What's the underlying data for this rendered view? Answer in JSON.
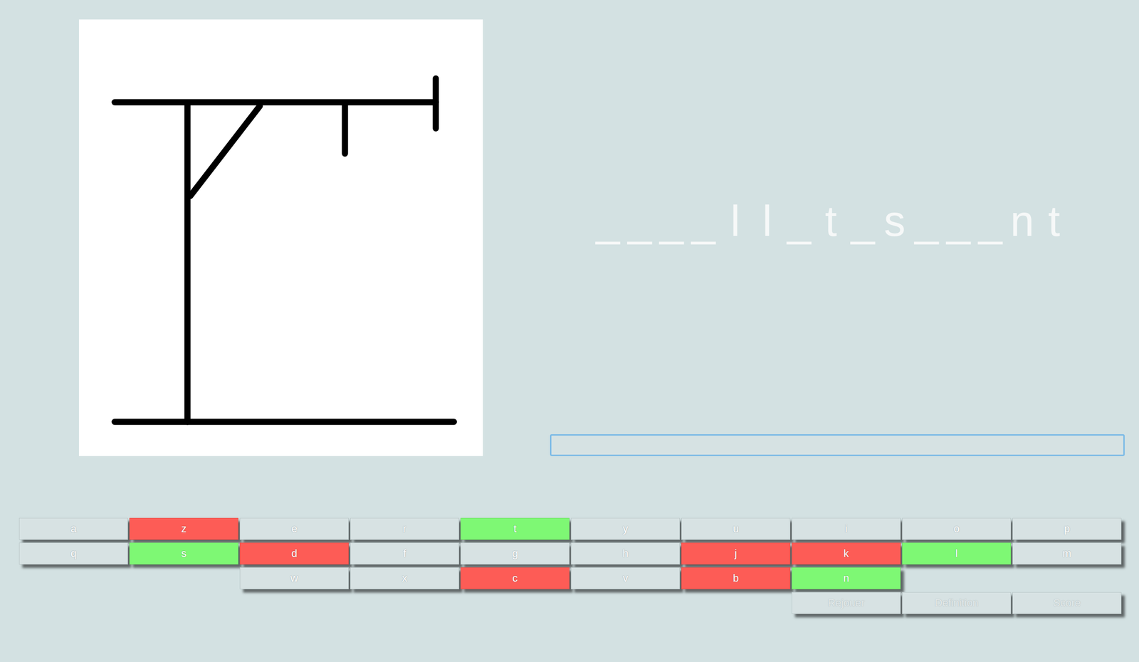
{
  "hangman": {
    "stage": 6
  },
  "word": {
    "slots": [
      "_",
      "_",
      "_",
      "_",
      "l",
      "l",
      "_",
      "t",
      "_",
      "s",
      "_",
      "_",
      "_",
      "n",
      "t"
    ]
  },
  "input": {
    "value": "",
    "focused": true
  },
  "keyboard": {
    "rows": [
      [
        {
          "label": "a",
          "status": "unused"
        },
        {
          "label": "z",
          "status": "wrong"
        },
        {
          "label": "e",
          "status": "unused"
        },
        {
          "label": "r",
          "status": "unused"
        },
        {
          "label": "t",
          "status": "correct"
        },
        {
          "label": "y",
          "status": "unused"
        },
        {
          "label": "u",
          "status": "unused"
        },
        {
          "label": "i",
          "status": "unused"
        },
        {
          "label": "o",
          "status": "unused"
        },
        {
          "label": "p",
          "status": "unused"
        }
      ],
      [
        {
          "label": "q",
          "status": "unused"
        },
        {
          "label": "s",
          "status": "correct"
        },
        {
          "label": "d",
          "status": "wrong"
        },
        {
          "label": "f",
          "status": "unused"
        },
        {
          "label": "g",
          "status": "unused"
        },
        {
          "label": "h",
          "status": "unused"
        },
        {
          "label": "j",
          "status": "wrong"
        },
        {
          "label": "k",
          "status": "wrong"
        },
        {
          "label": "l",
          "status": "correct"
        },
        {
          "label": "m",
          "status": "unused"
        }
      ],
      [
        {
          "label": "w",
          "status": "unused"
        },
        {
          "label": "x",
          "status": "unused"
        },
        {
          "label": "c",
          "status": "wrong"
        },
        {
          "label": "v",
          "status": "unused"
        },
        {
          "label": "b",
          "status": "wrong"
        },
        {
          "label": "n",
          "status": "correct"
        }
      ]
    ]
  },
  "actions": [
    {
      "label": "Rejouer",
      "disabled": true
    },
    {
      "label": "Definition",
      "disabled": true
    },
    {
      "label": "Score",
      "disabled": true
    }
  ]
}
